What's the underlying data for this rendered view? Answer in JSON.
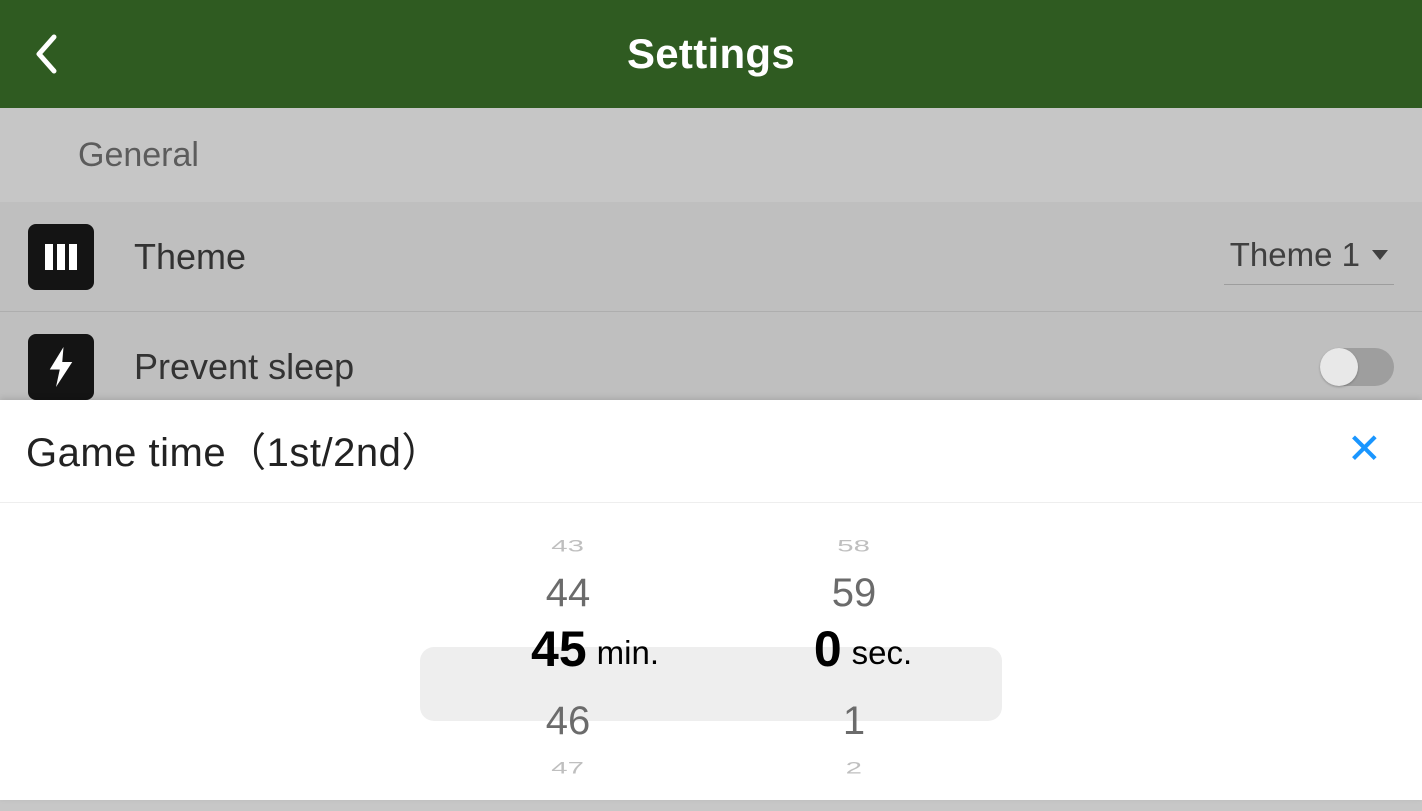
{
  "header": {
    "title": "Settings"
  },
  "section": {
    "general_label": "General"
  },
  "rows": {
    "theme": {
      "label": "Theme",
      "value": "Theme 1"
    },
    "sleep": {
      "label": "Prevent sleep"
    }
  },
  "sheet": {
    "title": "Game time（1st/2nd）",
    "close_glyph": "✕"
  },
  "picker": {
    "min": {
      "top_fade": "43",
      "prev2": "43",
      "prev1": "44",
      "selected": "45",
      "next1": "46",
      "next2": "47",
      "unit": "min."
    },
    "sec": {
      "top_fade": "58",
      "prev2": "58",
      "prev1": "59",
      "selected": "0",
      "next1": "1",
      "next2": "2",
      "unit": "sec."
    }
  }
}
